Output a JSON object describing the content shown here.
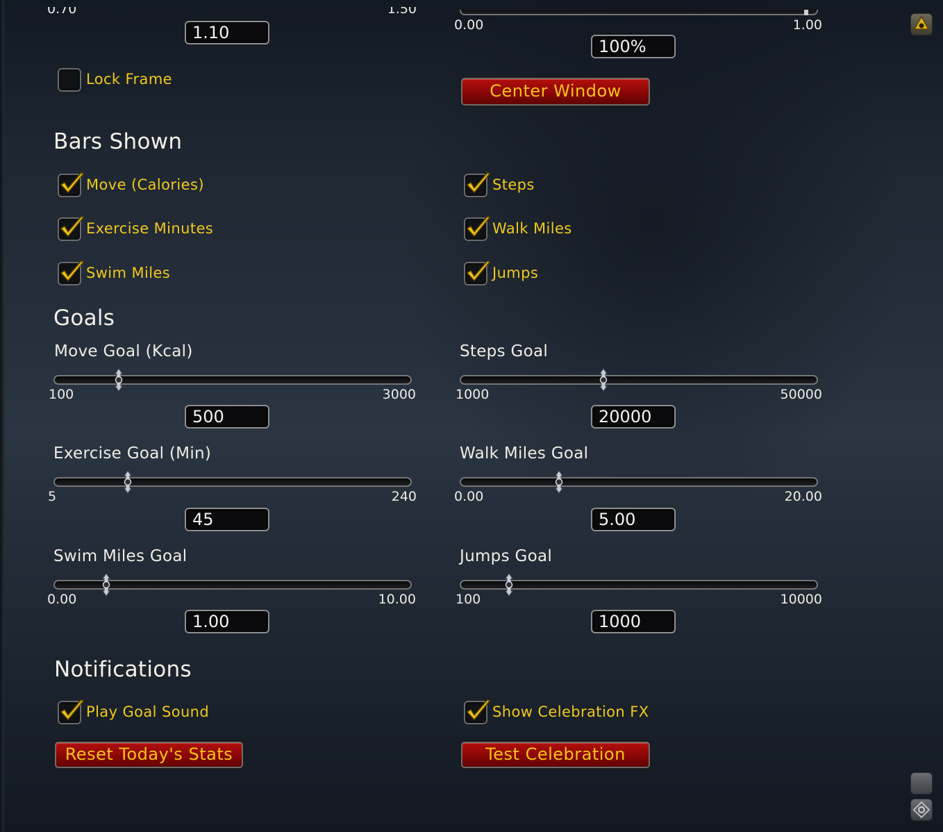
{
  "top": {
    "left_slider": {
      "min_tick": "0.70",
      "max_tick": "1.50",
      "value": "1.10"
    },
    "right_slider": {
      "min_tick": "0.00",
      "max_tick": "1.00",
      "value": "100%"
    },
    "lock_frame_label": "Lock Frame",
    "center_window_label": "Center Window"
  },
  "bars_shown": {
    "title": "Bars Shown",
    "items": [
      {
        "label": "Move (Calories)",
        "checked": true
      },
      {
        "label": "Steps",
        "checked": true
      },
      {
        "label": "Exercise Minutes",
        "checked": true
      },
      {
        "label": "Walk Miles",
        "checked": true
      },
      {
        "label": "Swim Miles",
        "checked": true
      },
      {
        "label": "Jumps",
        "checked": true
      }
    ]
  },
  "goals": {
    "title": "Goals",
    "sliders": [
      {
        "label": "Move Goal (Kcal)",
        "min": "100",
        "max": "3000",
        "value": "500"
      },
      {
        "label": "Steps Goal",
        "min": "1000",
        "max": "50000",
        "value": "20000"
      },
      {
        "label": "Exercise Goal (Min)",
        "min": "5",
        "max": "240",
        "value": "45"
      },
      {
        "label": "Walk Miles Goal",
        "min": "0.00",
        "max": "20.00",
        "value": "5.00"
      },
      {
        "label": "Swim Miles Goal",
        "min": "0.00",
        "max": "10.00",
        "value": "1.00"
      },
      {
        "label": "Jumps Goal",
        "min": "100",
        "max": "10000",
        "value": "1000"
      }
    ]
  },
  "notifications": {
    "title": "Notifications",
    "play_goal_sound": "Play Goal Sound",
    "show_celebration_fx": "Show Celebration FX",
    "reset_button": "Reset Today's Stats",
    "test_button": "Test Celebration"
  }
}
